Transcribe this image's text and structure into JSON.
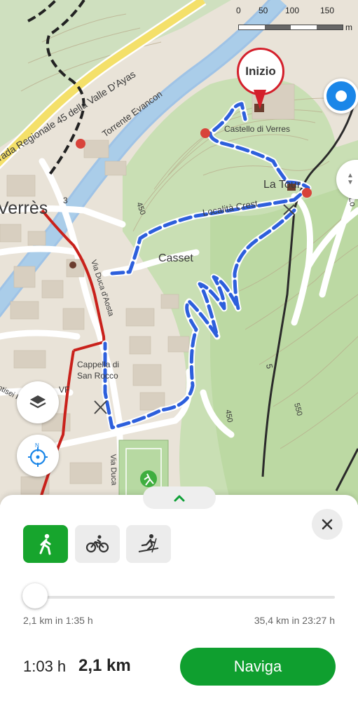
{
  "map": {
    "scale": {
      "ticks": [
        "0",
        "50",
        "100",
        "150"
      ],
      "unit": "m"
    },
    "labels": {
      "town": "Verrès",
      "road": "rada Regionale 45 della Valle D'Ayas",
      "river": "Torrente Evancon",
      "castle": "Castello di Verres",
      "la_tour": "La Tour",
      "crest": "Località Crest",
      "casset": "Casset",
      "chapel_line1": "Cappella di",
      "chapel_line2": "San Rocco",
      "street1": "Via Duca d'Aosta",
      "street2": "Via Duca",
      "street3": "ntisei Feb",
      "vf": "VF",
      "contour_450a": "450",
      "contour_450b": "450",
      "contour_550": "550",
      "road_3": "3",
      "road_5": "5",
      "road_lo": "Lo"
    },
    "start_marker": "Inizio"
  },
  "sheet": {
    "modes": [
      {
        "name": "walk",
        "icon": "walking-icon",
        "active": true
      },
      {
        "name": "bike",
        "icon": "bicycle-icon",
        "active": false
      },
      {
        "name": "ski",
        "icon": "ski-touring-icon",
        "active": false
      }
    ],
    "range_min": "2,1 km in 1:35 h",
    "range_max": "35,4 km in 23:27 h",
    "slider_fraction": 0,
    "duration": "1:03 h",
    "distance": "2,1 km",
    "navigate_label": "Naviga"
  },
  "colors": {
    "route": "#2d5fdc",
    "start": "#d41f2b",
    "accent_green": "#0f9f2f",
    "location_blue": "#1a86e8"
  }
}
